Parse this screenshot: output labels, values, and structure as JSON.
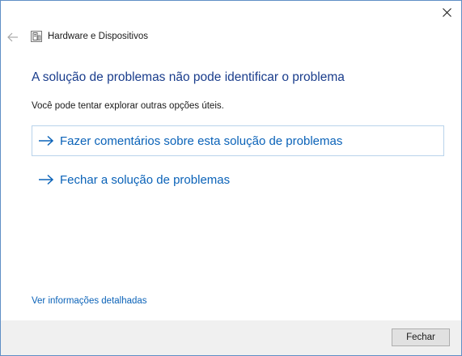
{
  "window": {
    "title": "Hardware e Dispositivos",
    "close_icon": "close-icon",
    "back_icon": "back-arrow-icon",
    "app_icon": "hardware-devices-icon"
  },
  "main": {
    "heading": "A solução de problemas não pode identificar o problema",
    "subtext": "Você pode tentar explorar outras opções úteis.",
    "options": [
      {
        "label": "Fazer comentários sobre esta solução de problemas",
        "icon": "arrow-right-icon"
      },
      {
        "label": "Fechar a solução de problemas",
        "icon": "arrow-right-icon"
      }
    ],
    "details_link": "Ver informações detalhadas"
  },
  "footer": {
    "close_button_label": "Fechar"
  },
  "colors": {
    "heading": "#1a3d8c",
    "link": "#0a62b8",
    "window_border": "#5f8fc6",
    "footer_bg": "#f0f0f0"
  }
}
